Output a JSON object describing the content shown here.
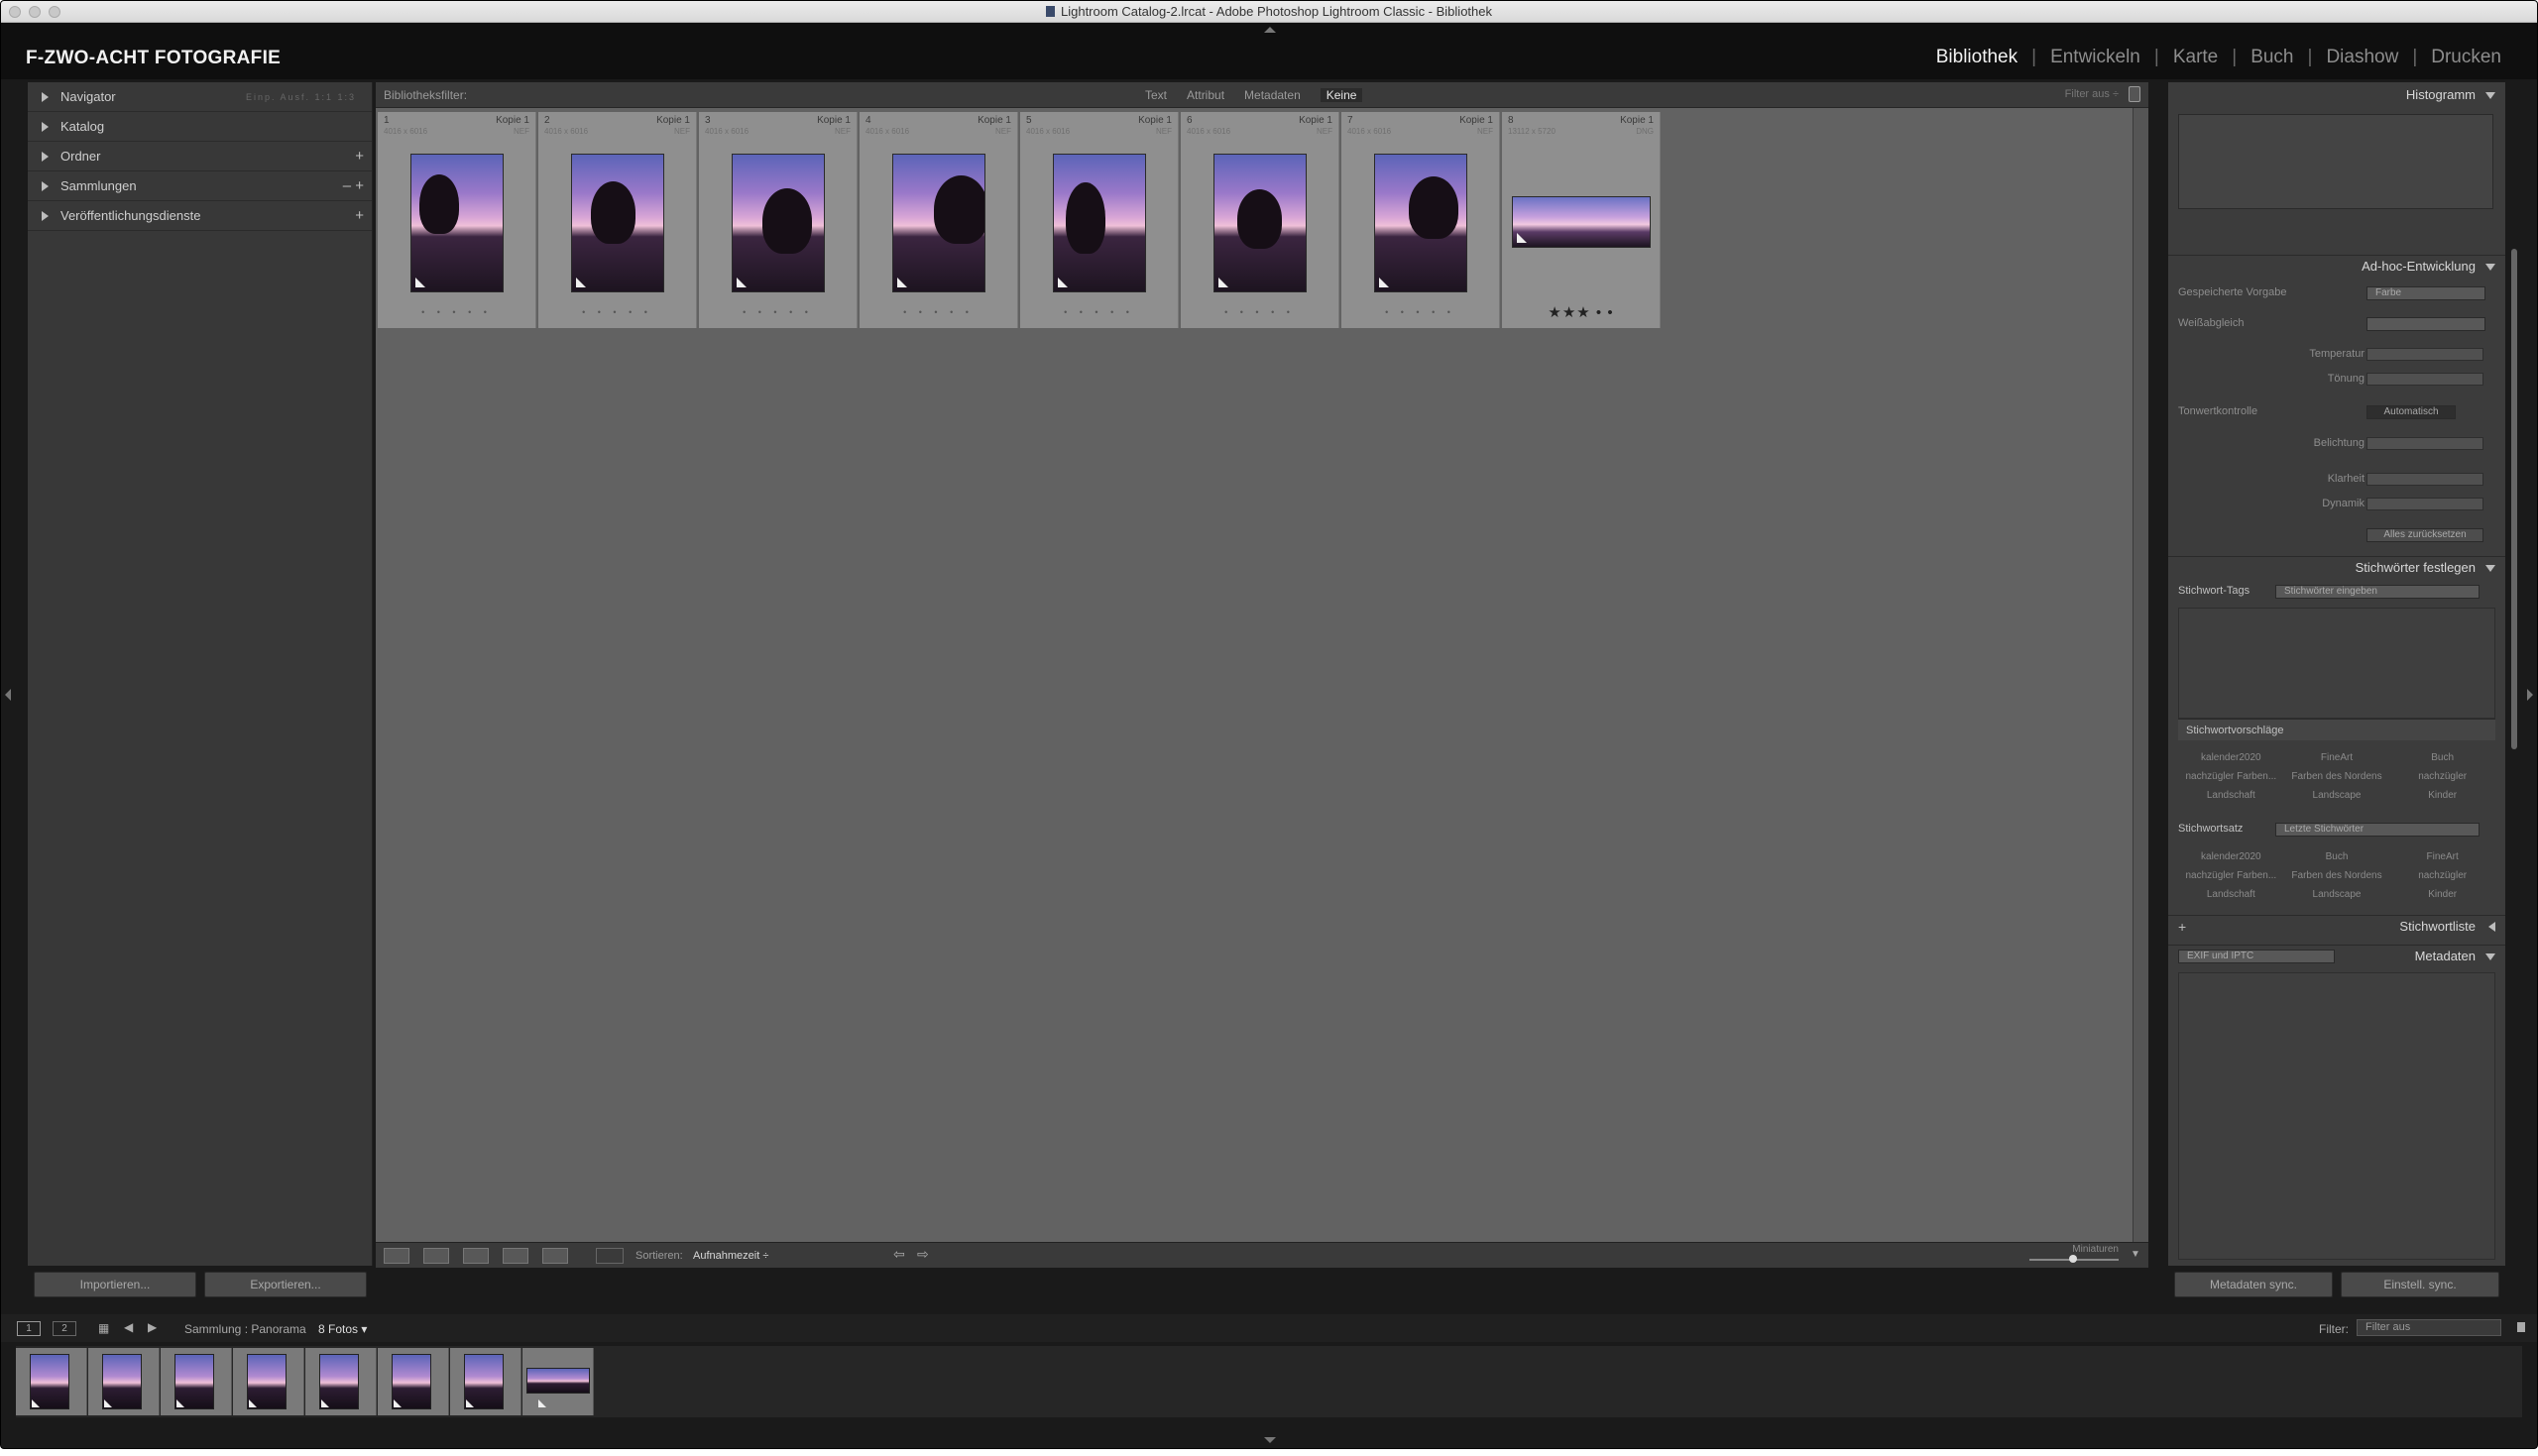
{
  "window": {
    "title": "Lightroom Catalog-2.lrcat - Adobe Photoshop Lightroom Classic - Bibliothek"
  },
  "brand": "F-ZWO-ACHT FOTOGRAFIE",
  "modules": [
    "Bibliothek",
    "Entwickeln",
    "Karte",
    "Buch",
    "Diashow",
    "Drucken"
  ],
  "active_module": "Bibliothek",
  "left_panel": {
    "navigator_options": "Einp.  Ausf.  1:1  1:3",
    "sections": [
      {
        "label": "Navigator",
        "ctrl": "▾"
      },
      {
        "label": "Katalog",
        "ctrl": ""
      },
      {
        "label": "Ordner",
        "ctrl": "+"
      },
      {
        "label": "Sammlungen",
        "ctrl": "–  +"
      },
      {
        "label": "Veröffentlichungsdienste",
        "ctrl": "+"
      }
    ],
    "import_button": "Importieren...",
    "export_button": "Exportieren..."
  },
  "filter_bar": {
    "title": "Bibliotheksfilter:",
    "tabs": [
      "Text",
      "Attribut",
      "Metadaten",
      "Keine"
    ],
    "active_tab": "Keine",
    "filter_off": "Filter aus ÷"
  },
  "grid": {
    "cells": [
      {
        "index": "1",
        "copy": "Kopie 1",
        "dims": "4016 x 6016",
        "format": "NEF",
        "pano": false,
        "stars": "• • • • •",
        "rated": false
      },
      {
        "index": "2",
        "copy": "Kopie 1",
        "dims": "4016 x 6016",
        "format": "NEF",
        "pano": false,
        "stars": "• • • • •",
        "rated": false
      },
      {
        "index": "3",
        "copy": "Kopie 1",
        "dims": "4016 x 6016",
        "format": "NEF",
        "pano": false,
        "stars": "• • • • •",
        "rated": false
      },
      {
        "index": "4",
        "copy": "Kopie 1",
        "dims": "4016 x 6016",
        "format": "NEF",
        "pano": false,
        "stars": "• • • • •",
        "rated": false
      },
      {
        "index": "5",
        "copy": "Kopie 1",
        "dims": "4016 x 6016",
        "format": "NEF",
        "pano": false,
        "stars": "• • • • •",
        "rated": false
      },
      {
        "index": "6",
        "copy": "Kopie 1",
        "dims": "4016 x 6016",
        "format": "NEF",
        "pano": false,
        "stars": "• • • • •",
        "rated": false
      },
      {
        "index": "7",
        "copy": "Kopie 1",
        "dims": "4016 x 6016",
        "format": "NEF",
        "pano": false,
        "stars": "• • • • •",
        "rated": false
      },
      {
        "index": "8",
        "copy": "Kopie 1",
        "dims": "13112 x 5720",
        "format": "DNG",
        "pano": true,
        "stars": "★★★ • •",
        "rated": true
      }
    ]
  },
  "toolbar": {
    "sort_label": "Sortieren:",
    "sort_value": "Aufnahmezeit ÷",
    "miniaturen": "Miniaturen"
  },
  "right_panel": {
    "histogram": "Histogramm",
    "quick_develop": "Ad-hoc-Entwicklung",
    "saved_preset_label": "Gespeicherte Vorgabe",
    "saved_preset_value": "Farbe",
    "white_balance_label": "Weißabgleich",
    "temperature_label": "Temperatur",
    "tint_label": "Tönung",
    "tone_control_label": "Tonwertkontrolle",
    "auto_button": "Automatisch",
    "exposure_label": "Belichtung",
    "clarity_label": "Klarheit",
    "vibrance_label": "Dynamik",
    "reset_button": "Alles zurücksetzen",
    "keywording": "Stichwörter festlegen",
    "keyword_tags_label": "Stichwort-Tags",
    "keyword_tags_value": "Stichwörter eingeben",
    "suggestions_title": "Stichwortvorschläge",
    "suggestions": [
      "kalender2020",
      "FineArt",
      "Buch",
      "nachzügler Farben...",
      "Farben des Nordens",
      "nachzügler",
      "Landschaft",
      "Landscape",
      "Kinder"
    ],
    "keyword_set_label": "Stichwortsatz",
    "keyword_set_value": "Letzte Stichwörter",
    "keyword_set": [
      "kalender2020",
      "Buch",
      "FineArt",
      "nachzügler Farben...",
      "Farben des Nordens",
      "nachzügler",
      "Landschaft",
      "Landscape",
      "Kinder"
    ],
    "keyword_list": "Stichwortliste",
    "metadata": "Metadaten",
    "metadata_preset": "EXIF und IPTC",
    "sync_metadata_button": "Metadaten sync.",
    "sync_settings_button": "Einstell. sync."
  },
  "filmstrip": {
    "page1": "1",
    "page2": "2",
    "path": "Sammlung : Panorama",
    "count": "8 Fotos ▾",
    "filter_label": "Filter:",
    "filter_value": "Filter aus"
  }
}
